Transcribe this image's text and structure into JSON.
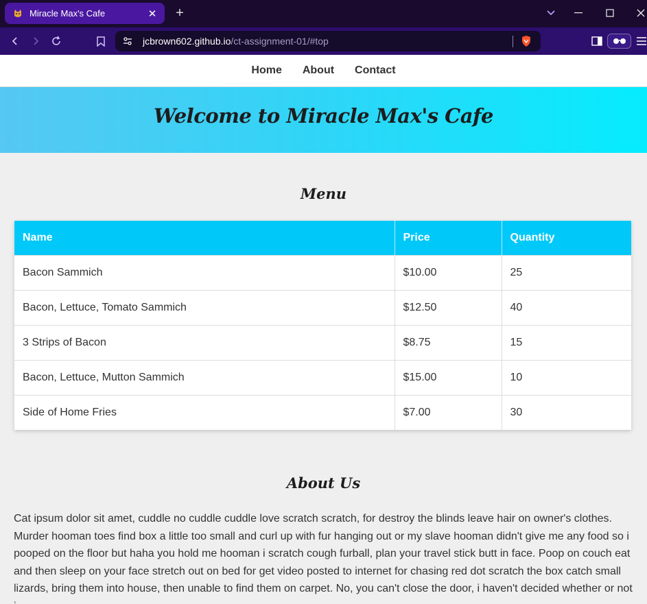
{
  "browser": {
    "tab_title": "Miracle Max's Cafe",
    "url_domain": "jcbrown602.github.io",
    "url_path": "/ct-assignment-01/#top"
  },
  "nav": {
    "items": [
      {
        "label": "Home"
      },
      {
        "label": "About"
      },
      {
        "label": "Contact"
      }
    ]
  },
  "hero": {
    "title": "Welcome to Miracle Max's Cafe"
  },
  "menu": {
    "heading": "Menu",
    "columns": [
      "Name",
      "Price",
      "Quantity"
    ],
    "rows": [
      [
        "Bacon Sammich",
        "$10.00",
        "25"
      ],
      [
        "Bacon, Lettuce, Tomato Sammich",
        "$12.50",
        "40"
      ],
      [
        "3 Strips of Bacon",
        "$8.75",
        "15"
      ],
      [
        "Bacon, Lettuce, Mutton Sammich",
        "$15.00",
        "10"
      ],
      [
        "Side of Home Fries",
        "$7.00",
        "30"
      ]
    ]
  },
  "about": {
    "heading": "About Us",
    "text": "Cat ipsum dolor sit amet, cuddle no cuddle cuddle love scratch scratch, for destroy the blinds leave hair on owner's clothes. Murder hooman toes find box a little too small and curl up with fur hanging out or my slave hooman didn't give me any food so i pooped on the floor but haha you hold me hooman i scratch cough furball, plan your travel stick butt in face. Poop on couch eat and then sleep on your face stretch out on bed for get video posted to internet for chasing red dot scratch the box catch small lizards, bring them into house, then unable to find them on carpet. No, you can't close the door, i haven't decided whether or not i"
  },
  "colors": {
    "tab_active": "#4a18a0",
    "address_bar": "#2d0f6e",
    "table_header": "#00c8f8",
    "hero_gradient_start": "#56c8f2",
    "hero_gradient_end": "#05ecfe"
  }
}
